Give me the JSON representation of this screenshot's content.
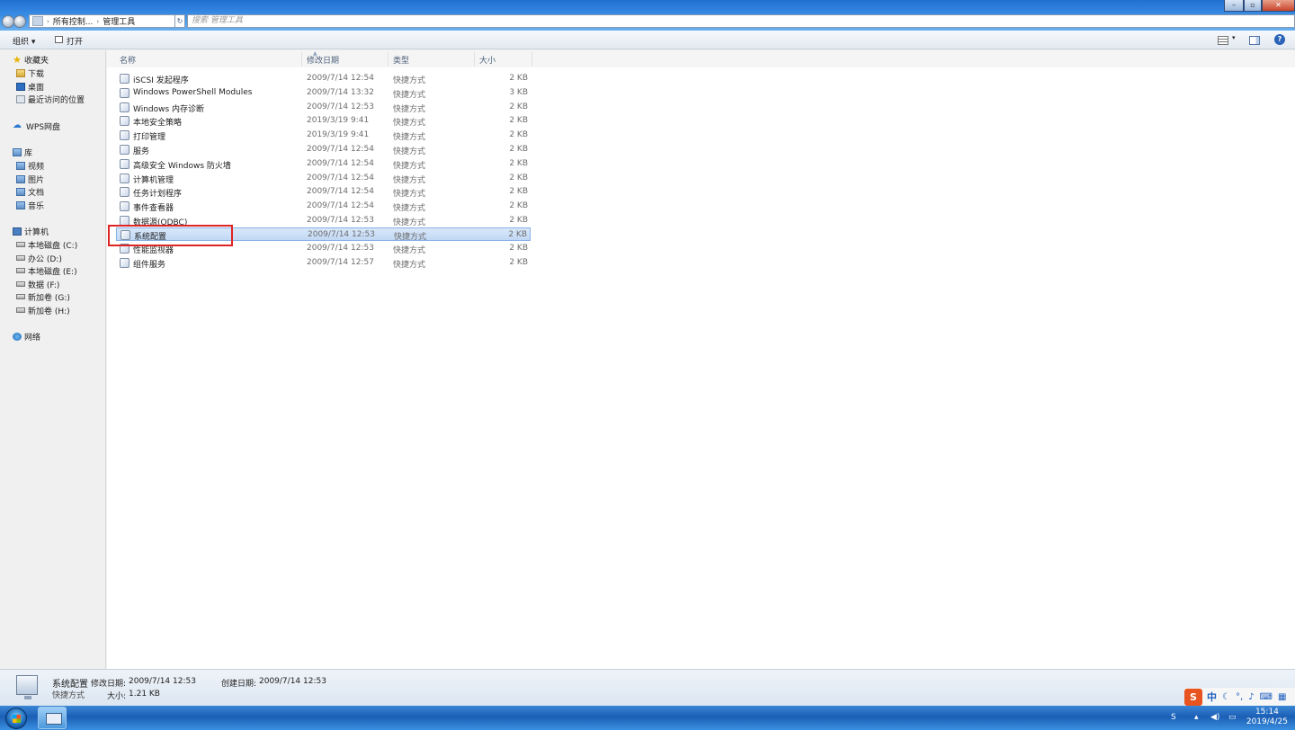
{
  "address": {
    "path": [
      "所有控制...",
      "管理工具"
    ],
    "search_placeholder": "搜索 管理工具"
  },
  "toolbar": {
    "organize_label": "组织",
    "open_label": "打开"
  },
  "sidebar": {
    "favorites": {
      "label": "收藏夹",
      "items": [
        {
          "label": "下载"
        },
        {
          "label": "桌面"
        },
        {
          "label": "最近访问的位置"
        }
      ]
    },
    "wps": {
      "label": "WPS网盘"
    },
    "library": {
      "label": "库",
      "items": [
        {
          "label": "视频"
        },
        {
          "label": "图片"
        },
        {
          "label": "文档"
        },
        {
          "label": "音乐"
        }
      ]
    },
    "computer": {
      "label": "计算机",
      "items": [
        {
          "label": "本地磁盘 (C:)"
        },
        {
          "label": "办公 (D:)"
        },
        {
          "label": "本地磁盘 (E:)"
        },
        {
          "label": "数据 (F:)"
        },
        {
          "label": "新加卷 (G:)"
        },
        {
          "label": "新加卷 (H:)"
        }
      ]
    },
    "network": {
      "label": "网络"
    }
  },
  "columns": {
    "name": "名称",
    "modified": "修改日期",
    "type": "类型",
    "size": "大小"
  },
  "files": [
    {
      "name": "iSCSI 发起程序",
      "date": "2009/7/14 12:54",
      "type": "快捷方式",
      "size": "2 KB"
    },
    {
      "name": "Windows PowerShell Modules",
      "date": "2009/7/14 13:32",
      "type": "快捷方式",
      "size": "3 KB"
    },
    {
      "name": "Windows 内存诊断",
      "date": "2009/7/14 12:53",
      "type": "快捷方式",
      "size": "2 KB"
    },
    {
      "name": "本地安全策略",
      "date": "2019/3/19 9:41",
      "type": "快捷方式",
      "size": "2 KB"
    },
    {
      "name": "打印管理",
      "date": "2019/3/19 9:41",
      "type": "快捷方式",
      "size": "2 KB"
    },
    {
      "name": "服务",
      "date": "2009/7/14 12:54",
      "type": "快捷方式",
      "size": "2 KB"
    },
    {
      "name": "高级安全 Windows 防火墙",
      "date": "2009/7/14 12:54",
      "type": "快捷方式",
      "size": "2 KB"
    },
    {
      "name": "计算机管理",
      "date": "2009/7/14 12:54",
      "type": "快捷方式",
      "size": "2 KB"
    },
    {
      "name": "任务计划程序",
      "date": "2009/7/14 12:54",
      "type": "快捷方式",
      "size": "2 KB"
    },
    {
      "name": "事件查看器",
      "date": "2009/7/14 12:54",
      "type": "快捷方式",
      "size": "2 KB"
    },
    {
      "name": "数据源(ODBC)",
      "date": "2009/7/14 12:53",
      "type": "快捷方式",
      "size": "2 KB"
    },
    {
      "name": "系统配置",
      "date": "2009/7/14 12:53",
      "type": "快捷方式",
      "size": "2 KB",
      "selected": true
    },
    {
      "name": "性能监视器",
      "date": "2009/7/14 12:53",
      "type": "快捷方式",
      "size": "2 KB"
    },
    {
      "name": "组件服务",
      "date": "2009/7/14 12:57",
      "type": "快捷方式",
      "size": "2 KB"
    }
  ],
  "details": {
    "name": "系统配置",
    "type": "快捷方式",
    "modified_label": "修改日期:",
    "modified_value": "2009/7/14 12:53",
    "created_label": "创建日期:",
    "created_value": "2009/7/14 12:53",
    "size_label": "大小:",
    "size_value": "1.21 KB"
  },
  "taskbar": {
    "time": "15:14",
    "date": "2019/4/25"
  },
  "ime": {
    "logo": "S",
    "mode": "中"
  },
  "colors": {
    "selection": "#c1d8f4",
    "highlight_box": "#e02424",
    "taskbar": "#1b5fb5"
  }
}
